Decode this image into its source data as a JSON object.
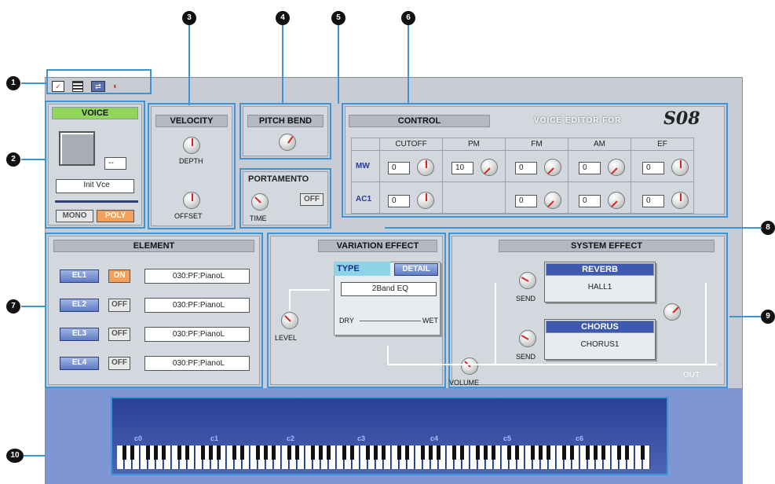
{
  "callouts": [
    "1",
    "2",
    "3",
    "4",
    "5",
    "6",
    "7",
    "8",
    "9",
    "10"
  ],
  "toolbar": {
    "icons": [
      "voice-edit-icon",
      "list-icon",
      "transfer-icon",
      "audition-icon"
    ]
  },
  "voice": {
    "title": "VOICE",
    "number": "--",
    "name": "Init Vce",
    "mono": "MONO",
    "poly": "POLY"
  },
  "velocity": {
    "title": "VELOCITY",
    "depth": "DEPTH",
    "offset": "OFFSET"
  },
  "pitch_bend": {
    "title": "PITCH BEND"
  },
  "portamento": {
    "title": "PORTAMENTO",
    "off": "OFF",
    "time": "TIME"
  },
  "control": {
    "title": "CONTROL",
    "brand": "VOICE EDITOR FOR",
    "logo": "S08",
    "cols": [
      "CUTOFF",
      "PM",
      "FM",
      "AM",
      "EF"
    ],
    "rows": [
      {
        "label": "MW",
        "vals": [
          "0",
          "10",
          "0",
          "0",
          "0"
        ]
      },
      {
        "label": "AC1",
        "vals": [
          "0",
          "",
          "0",
          "0",
          "0"
        ]
      }
    ]
  },
  "element": {
    "title": "ELEMENT",
    "items": [
      {
        "el": "EL1",
        "state": "ON",
        "voice": "030:PF:PianoL"
      },
      {
        "el": "EL2",
        "state": "OFF",
        "voice": "030:PF:PianoL"
      },
      {
        "el": "EL3",
        "state": "OFF",
        "voice": "030:PF:PianoL"
      },
      {
        "el": "EL4",
        "state": "OFF",
        "voice": "030:PF:PianoL"
      }
    ]
  },
  "variation": {
    "title": "VARIATION EFFECT",
    "type": "TYPE",
    "detail": "DETAIL",
    "value": "2Band EQ",
    "dry": "DRY",
    "wet": "WET",
    "level": "LEVEL"
  },
  "system": {
    "title": "SYSTEM EFFECT",
    "reverb": "REVERB",
    "reverb_type": "HALL1",
    "chorus": "CHORUS",
    "chorus_type": "CHORUS1",
    "send": "SEND",
    "volume": "VOLUME",
    "out": "OUT"
  },
  "keyboard": {
    "octaves": [
      "c0",
      "c1",
      "c2",
      "c3",
      "c4",
      "c5",
      "c6"
    ]
  }
}
